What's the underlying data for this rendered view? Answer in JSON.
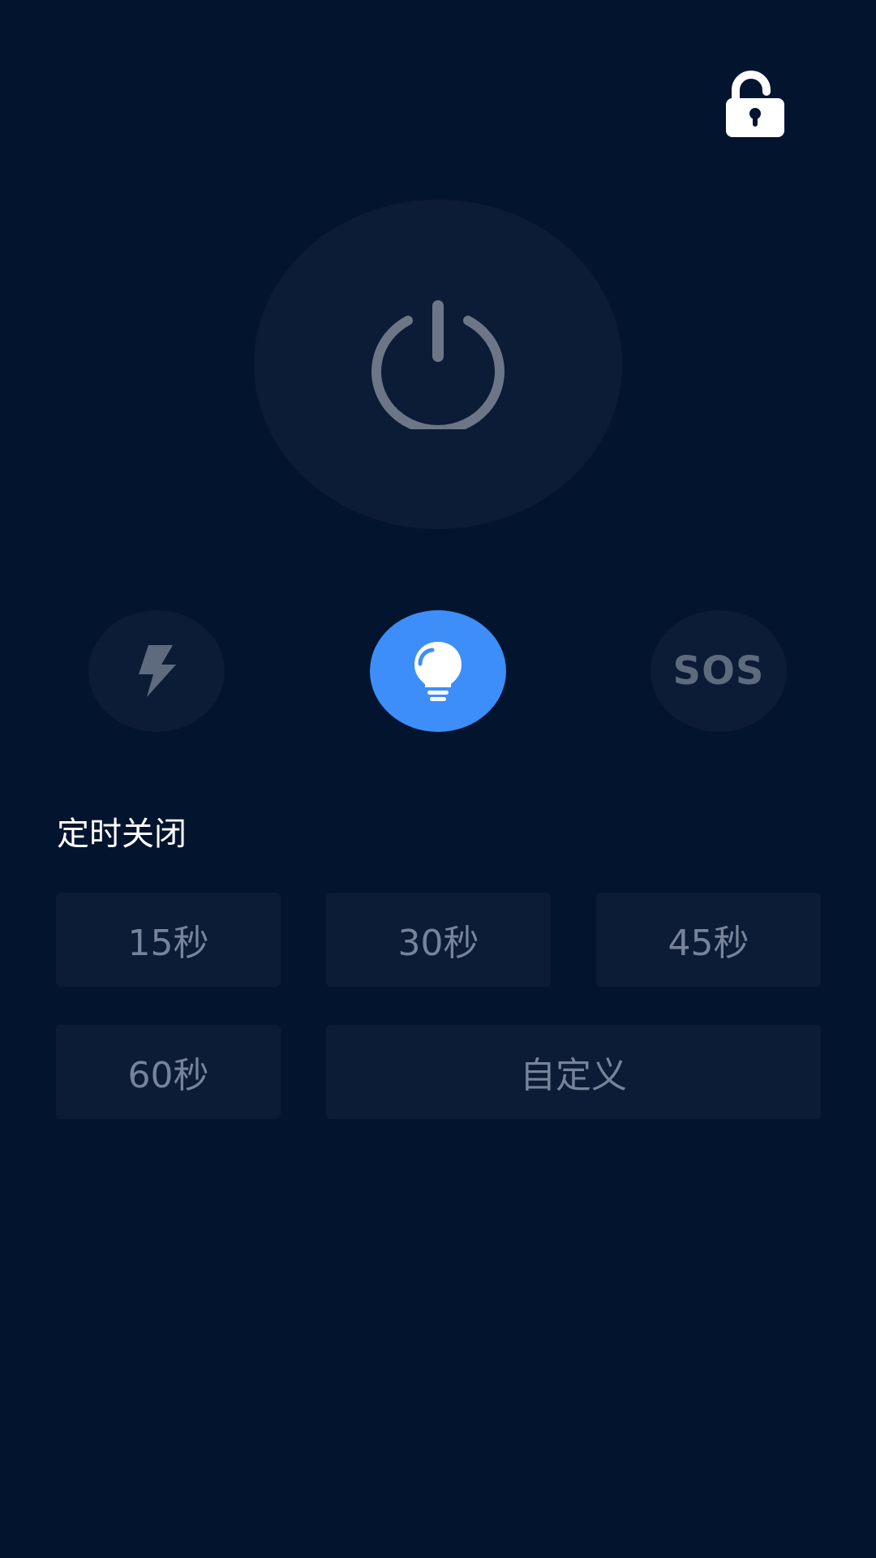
{
  "colors": {
    "background": "#03142e",
    "button_bg": "#0c1c36",
    "accent": "#3d8ef8",
    "muted": "#77839a",
    "text_white": "#ffffff"
  },
  "lock": {
    "icon": "unlocked-padlock-icon"
  },
  "power": {
    "icon": "power-icon"
  },
  "modes": {
    "flash": {
      "icon": "lightning-bolt-icon"
    },
    "light": {
      "icon": "light-bulb-icon",
      "selected": true
    },
    "sos": {
      "label": "SOS"
    }
  },
  "timer": {
    "title": "定时关闭",
    "options": {
      "s15": "15秒",
      "s30": "30秒",
      "s45": "45秒",
      "s60": "60秒",
      "custom": "自定义"
    }
  }
}
